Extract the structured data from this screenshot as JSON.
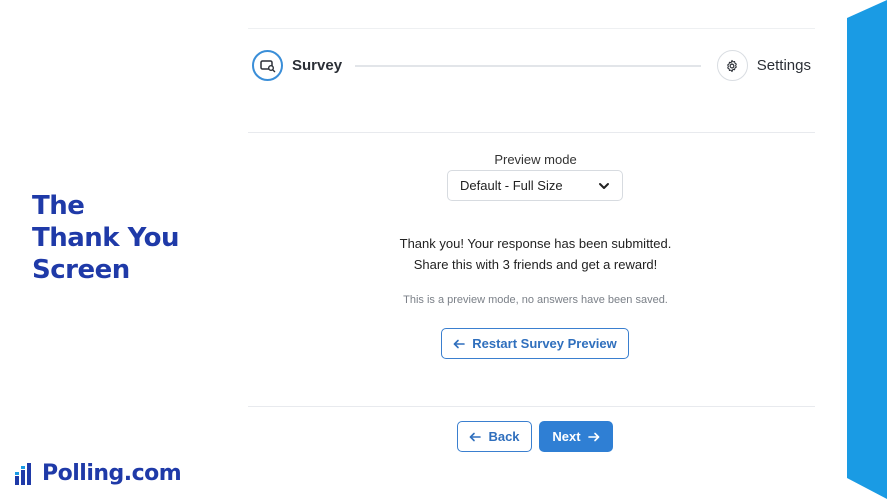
{
  "slide": {
    "title_lines": [
      "The",
      "Thank You",
      "Screen"
    ],
    "brand_name": "Polling.com",
    "title_color": "#1f3aa8",
    "band_color": "#1a9be4"
  },
  "stepper": {
    "steps": [
      {
        "label": "Survey",
        "icon": "survey-search-icon",
        "state": "active"
      },
      {
        "label": "Settings",
        "icon": "gear-icon",
        "state": "idle"
      }
    ]
  },
  "preview": {
    "label": "Preview mode",
    "selected": "Default - Full Size"
  },
  "message": {
    "line1": "Thank you! Your response has been submitted.",
    "line2": "Share this with 3 friends and get a reward!",
    "note": "This is a preview mode, no answers have been saved."
  },
  "actions": {
    "restart_label": "Restart Survey Preview",
    "back_label": "Back",
    "next_label": "Next"
  },
  "colors": {
    "accent": "#2f7fd4",
    "accent_border": "#3a7fcf"
  }
}
